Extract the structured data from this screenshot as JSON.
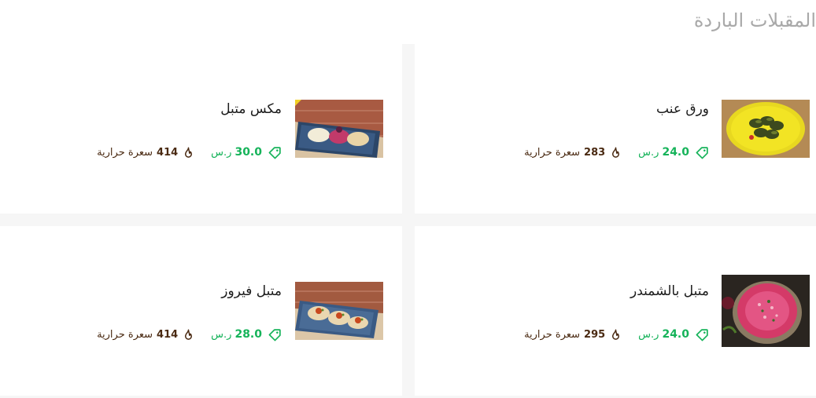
{
  "section": {
    "title": "المقبلات الباردة"
  },
  "dishes": [
    {
      "name": "ورق عنب",
      "price": "24.0",
      "currency": "ر.س",
      "calories": "283",
      "calories_unit": "سعرة حرارية",
      "image": "grape-leaves-photo"
    },
    {
      "name": "مكس متبل",
      "price": "30.0",
      "currency": "ر.س",
      "calories": "414",
      "calories_unit": "سعرة حرارية",
      "image": "mix-mutabal-photo"
    },
    {
      "name": "متبل بالشمندر",
      "price": "24.0",
      "currency": "ر.س",
      "calories": "295",
      "calories_unit": "سعرة حرارية",
      "image": "beetroot-mutabal-photo"
    },
    {
      "name": "متبل فيروز",
      "price": "28.0",
      "currency": "ر.س",
      "calories": "414",
      "calories_unit": "سعرة حرارية",
      "image": "fairouz-mutabal-photo"
    }
  ],
  "icons": {
    "price": "price-tag-icon",
    "calories": "flame-icon"
  },
  "colors": {
    "price": "#16b35a",
    "calories": "#4a2a12",
    "title": "#a9a9a9",
    "separator": "#f6f6f6"
  }
}
